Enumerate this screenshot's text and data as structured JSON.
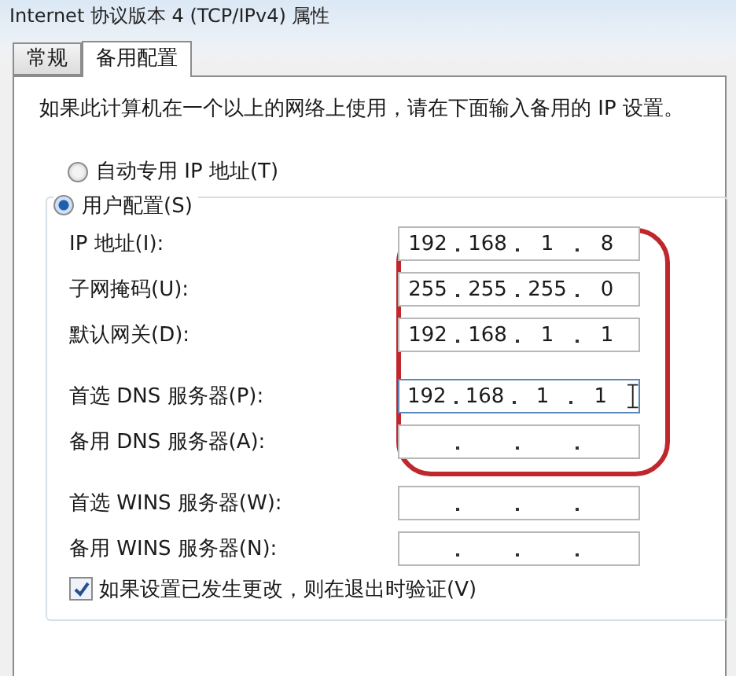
{
  "window": {
    "title": "Internet 协议版本 4 (TCP/IPv4) 属性"
  },
  "tabs": [
    {
      "label": "常规",
      "selected": false
    },
    {
      "label": "备用配置",
      "selected": true
    }
  ],
  "description": "如果此计算机在一个以上的网络上使用，请在下面输入备用的 IP 设置。",
  "radios": [
    {
      "label": "自动专用 IP 地址(T)",
      "selected": false
    },
    {
      "label": "用户配置(S)",
      "selected": true
    }
  ],
  "field_groups": [
    [
      {
        "label": "IP 地址(I):",
        "octets": [
          "192",
          "168",
          "1",
          "8"
        ],
        "focused": false
      },
      {
        "label": "子网掩码(U):",
        "octets": [
          "255",
          "255",
          "255",
          "0"
        ],
        "focused": false
      },
      {
        "label": "默认网关(D):",
        "octets": [
          "192",
          "168",
          "1",
          "1"
        ],
        "focused": false
      }
    ],
    [
      {
        "label": "首选 DNS 服务器(P):",
        "octets": [
          "192",
          "168",
          "1",
          "1"
        ],
        "focused": true
      },
      {
        "label": "备用 DNS 服务器(A):",
        "focused": false
      }
    ],
    [
      {
        "label": "首选 WINS 服务器(W):",
        "focused": false
      },
      {
        "label": "备用 WINS 服务器(N):",
        "focused": false
      }
    ]
  ],
  "annotation": {
    "kind": "outline"
  },
  "validate": {
    "label": "如果设置已发生更改，则在退出时验证(V)",
    "checked": true
  }
}
